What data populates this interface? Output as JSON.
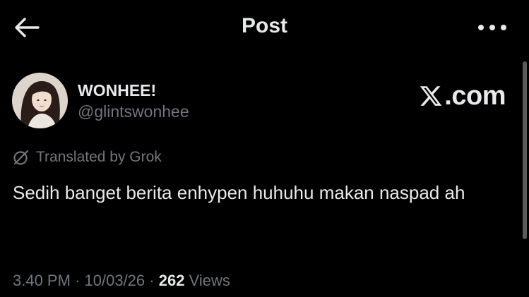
{
  "header": {
    "title": "Post"
  },
  "author": {
    "display_name": "WONHEE!",
    "handle": "@glintswonhee"
  },
  "watermark": {
    "text": ".com"
  },
  "translation": {
    "label": "Translated by Grok"
  },
  "post": {
    "text": "Sedih banget berita enhypen huhuhu makan naspad ah"
  },
  "meta": {
    "time": "3.40 PM",
    "separator": "·",
    "date": "10/03/26",
    "views_count": "262",
    "views_label": "Views"
  },
  "icons": {
    "back": "back-arrow-icon",
    "more": "more-dots-icon",
    "translate": "grok-icon",
    "logo": "x-logo-icon"
  },
  "colors": {
    "background": "#000000",
    "primary_text": "#e7e9ea",
    "secondary_text": "#71767b"
  }
}
